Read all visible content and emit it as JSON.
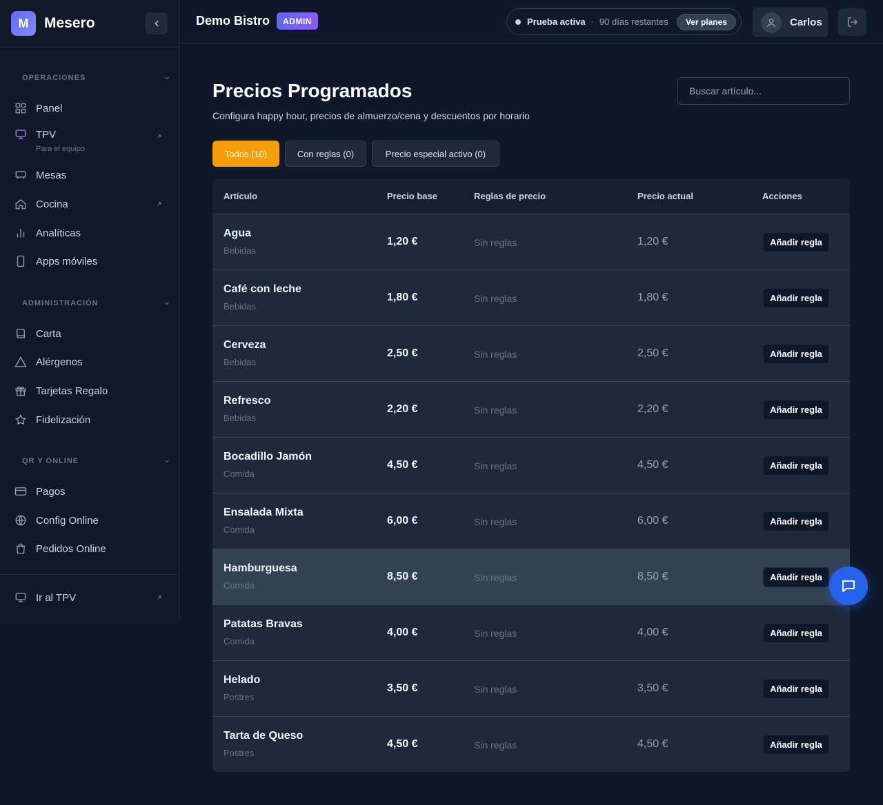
{
  "app": {
    "logo_letter": "M",
    "name": "Mesero"
  },
  "sidebar": {
    "sections": [
      {
        "label": "OPERACIONES"
      },
      {
        "label": "ADMINISTRACIÓN"
      },
      {
        "label": "QR Y ONLINE"
      }
    ],
    "items": [
      {
        "label": "Panel",
        "icon": "grid-icon"
      },
      {
        "label": "TPV",
        "sub": "Para el equipo",
        "icon": "monitor-icon",
        "external": true
      },
      {
        "label": "Mesas",
        "icon": "table-icon"
      },
      {
        "label": "Cocina",
        "icon": "home-icon",
        "external": true
      },
      {
        "label": "Analíticas",
        "icon": "bar-chart-icon"
      },
      {
        "label": "Apps móviles",
        "icon": "smartphone-icon"
      },
      {
        "label": "Carta",
        "icon": "book-icon"
      },
      {
        "label": "Alérgenos",
        "icon": "warning-icon"
      },
      {
        "label": "Tarjetas Regalo",
        "icon": "gift-icon"
      },
      {
        "label": "Fidelización",
        "icon": "star-icon"
      },
      {
        "label": "Pagos",
        "icon": "credit-card-icon"
      },
      {
        "label": "Config Online",
        "icon": "globe-icon"
      },
      {
        "label": "Pedidos Online",
        "icon": "shopping-bag-icon"
      }
    ],
    "footer": {
      "label": "Ir al TPV",
      "icon": "monitor-icon"
    }
  },
  "topbar": {
    "venue": "Demo Bistro",
    "role_badge": "ADMIN",
    "trial_status": "Prueba activa",
    "trial_separator": "·",
    "trial_remaining": "90 días restantes",
    "plans_button": "Ver planes",
    "user_name": "Carlos"
  },
  "page": {
    "title": "Precios Programados",
    "subtitle": "Configura happy hour, precios de almuerzo/cena y descuentos por horario",
    "search_placeholder": "Buscar artículo...",
    "tabs": [
      {
        "label": "Todos (10)",
        "active": true
      },
      {
        "label": "Con reglas (0)",
        "active": false
      },
      {
        "label": "Precio especial activo (0)",
        "active": false
      }
    ]
  },
  "table": {
    "columns": [
      "Artículo",
      "Precio base",
      "Reglas de precio",
      "Precio actual",
      "Acciones"
    ],
    "rows": [
      {
        "name": "Agua",
        "category": "Bebidas",
        "base": "1,20 €",
        "rules": "Sin reglas",
        "current": "1,20 €",
        "action": "Añadir regla"
      },
      {
        "name": "Café con leche",
        "category": "Bebidas",
        "base": "1,80 €",
        "rules": "Sin reglas",
        "current": "1,80 €",
        "action": "Añadir regla"
      },
      {
        "name": "Cerveza",
        "category": "Bebidas",
        "base": "2,50 €",
        "rules": "Sin reglas",
        "current": "2,50 €",
        "action": "Añadir regla"
      },
      {
        "name": "Refresco",
        "category": "Bebidas",
        "base": "2,20 €",
        "rules": "Sin reglas",
        "current": "2,20 €",
        "action": "Añadir regla"
      },
      {
        "name": "Bocadillo Jamón",
        "category": "Comida",
        "base": "4,50 €",
        "rules": "Sin reglas",
        "current": "4,50 €",
        "action": "Añadir regla"
      },
      {
        "name": "Ensalada Mixta",
        "category": "Comida",
        "base": "6,00 €",
        "rules": "Sin reglas",
        "current": "6,00 €",
        "action": "Añadir regla"
      },
      {
        "name": "Hamburguesa",
        "category": "Comida",
        "base": "8,50 €",
        "rules": "Sin reglas",
        "current": "8,50 €",
        "action": "Añadir regla"
      },
      {
        "name": "Patatas Bravas",
        "category": "Comida",
        "base": "4,00 €",
        "rules": "Sin reglas",
        "current": "4,00 €",
        "action": "Añadir regla"
      },
      {
        "name": "Helado",
        "category": "Postres",
        "base": "3,50 €",
        "rules": "Sin reglas",
        "current": "3,50 €",
        "action": "Añadir regla"
      },
      {
        "name": "Tarta de Queso",
        "category": "Postres",
        "base": "4,50 €",
        "rules": "Sin reglas",
        "current": "4,50 €",
        "action": "Añadir regla"
      }
    ]
  },
  "colors": {
    "accent": "#f59e0b",
    "brand": "#6366f1",
    "chat": "#2563eb"
  }
}
